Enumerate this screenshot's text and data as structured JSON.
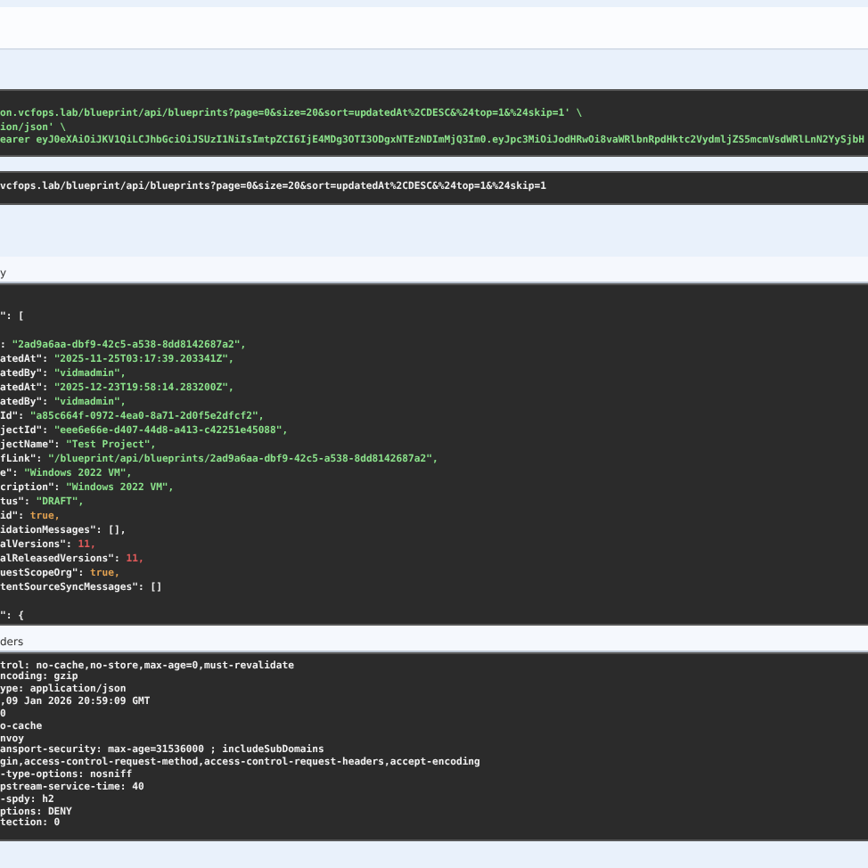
{
  "curl_command": [
    "on.vcfops.lab/blueprint/api/blueprints?page=0&size=20&sort=updatedAt%2CDESC&%24top=1&%24skip=1' \\",
    "ion/json' \\",
    "earer eyJ0eXAiOiJKV1QiLCJhbGciOiJSUzI1NiIsImtpZCI6IjE4MDg3OTI3ODgxNTEzNDImMjQ3Im0.eyJpc3MiOiJodHRwOi8vaWRlbnRpdHktc2VydmljZS5mcmVsdWRlLnN2YySjbH"
  ],
  "request_url": "vcfops.lab/blueprint/api/blueprints?page=0&size=20&sort=updatedAt%2CDESC&%24top=1&%24skip=1",
  "response_body": {
    "heading": "y",
    "lines": [
      {
        "key": "\": [",
        "kind": "punct"
      },
      {
        "kind": "blank"
      },
      {
        "key": ": ",
        "value": "\"2ad9a6aa-dbf9-42c5-a538-8dd8142687a2\",",
        "kind": "string"
      },
      {
        "key": "atedAt\": ",
        "value": "\"2025-11-25T03:17:39.203341Z\",",
        "kind": "string"
      },
      {
        "key": "atedBy\": ",
        "value": "\"vidmadmin\",",
        "kind": "string"
      },
      {
        "key": "atedAt\": ",
        "value": "\"2025-12-23T19:58:14.283200Z\",",
        "kind": "string"
      },
      {
        "key": "atedBy\": ",
        "value": "\"vidmadmin\",",
        "kind": "string"
      },
      {
        "key": "Id\": ",
        "value": "\"a85c664f-0972-4ea0-8a71-2d0f5e2dfcf2\",",
        "kind": "string"
      },
      {
        "key": "jectId\": ",
        "value": "\"eee6e66e-d407-44d8-a413-c42251e45088\",",
        "kind": "string"
      },
      {
        "key": "jectName\": ",
        "value": "\"Test Project\",",
        "kind": "string"
      },
      {
        "key": "fLink\": ",
        "value": "\"/blueprint/api/blueprints/2ad9a6aa-dbf9-42c5-a538-8dd8142687a2\",",
        "kind": "string"
      },
      {
        "key": "e\": ",
        "value": "\"Windows 2022 VM\",",
        "kind": "string"
      },
      {
        "key": "cription\": ",
        "value": "\"Windows 2022 VM\",",
        "kind": "string"
      },
      {
        "key": "tus\": ",
        "value": "\"DRAFT\",",
        "kind": "string"
      },
      {
        "key": "id\": ",
        "value": "true,",
        "kind": "boolean"
      },
      {
        "key": "idationMessages\": ",
        "value": "[],",
        "kind": "punct"
      },
      {
        "key": "alVersions\": ",
        "value": "11,",
        "kind": "number"
      },
      {
        "key": "alReleasedVersions\": ",
        "value": "11,",
        "kind": "number"
      },
      {
        "key": "uestScopeOrg\": ",
        "value": "true,",
        "kind": "boolean"
      },
      {
        "key": "tentSourceSyncMessages\": ",
        "value": "[]",
        "kind": "punct"
      },
      {
        "kind": "blank"
      },
      {
        "key": "\": {",
        "kind": "punct"
      }
    ]
  },
  "response_headers": {
    "heading": "ders",
    "lines": [
      "trol: no-cache,no-store,max-age=0,must-revalidate",
      "ncoding: gzip",
      "ype: application/json",
      ",09 Jan 2026 20:59:09 GMT",
      "0",
      "o-cache",
      "nvoy",
      "ansport-security: max-age=31536000 ; includeSubDomains",
      "gin,access-control-request-method,access-control-request-headers,accept-encoding",
      "-type-options: nosniff",
      "pstream-service-time: 40",
      "-spdy: h2",
      "ptions: DENY",
      "tection: 0"
    ]
  }
}
